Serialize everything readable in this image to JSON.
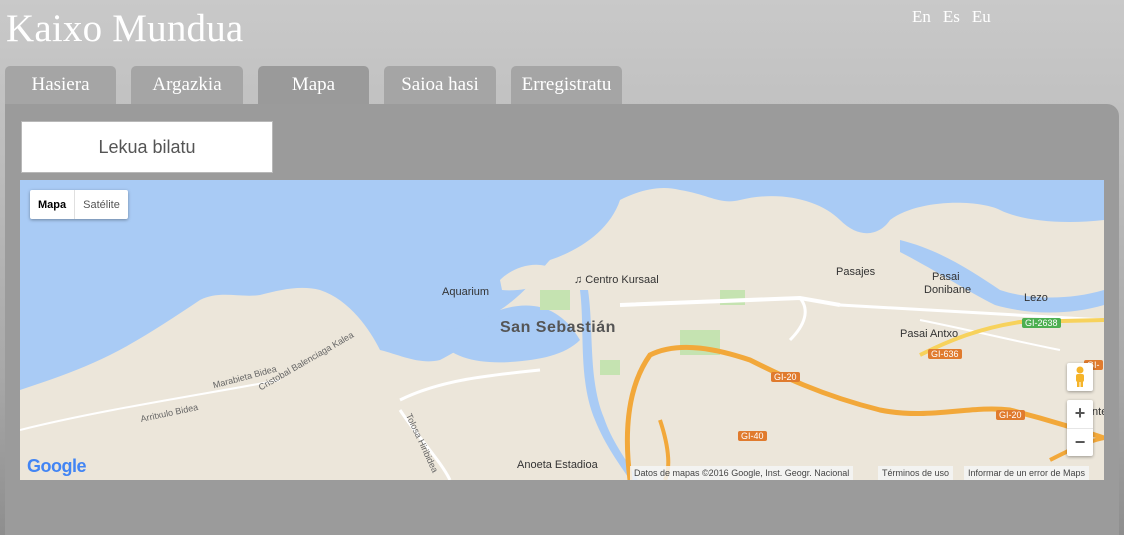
{
  "site": {
    "title": "Kaixo Mundua"
  },
  "languages": [
    "En",
    "Es",
    "Eu"
  ],
  "tabs": [
    {
      "label": "Hasiera"
    },
    {
      "label": "Argazkia"
    },
    {
      "label": "Mapa"
    },
    {
      "label": "Saioa hasi"
    },
    {
      "label": "Erregistratu"
    }
  ],
  "search": {
    "label": "Lekua bilatu"
  },
  "map": {
    "type_control": {
      "selected": "Mapa",
      "other": "Satélite"
    },
    "city": "San Sebastián",
    "places": {
      "aquarium": "Aquarium",
      "kursaal": "♫ Centro Kursaal",
      "pasajes": "Pasajes",
      "pasai_donibane_1": "Pasai",
      "pasai_donibane_2": "Donibane",
      "lezo": "Lezo",
      "pasai_antxo": "Pasai Antxo",
      "anoeta": "Anoeta Estadioa",
      "renteria": "Renteri"
    },
    "streets": {
      "arrituxulo": "Arritxulo Bidea",
      "marabieta": "Marabieta Bidea",
      "balenciaga": "Cristobal Balenciaga Kalea",
      "tolosa": "Tolosa Hiribidea"
    },
    "road_badges": {
      "gi20_a": "GI-20",
      "gi20_b": "GI-20",
      "gi40": "GI-40",
      "gi636": "GI-636",
      "gi2638": "GI-2638",
      "gi_partial": "GI-"
    },
    "zoom_in": "+",
    "zoom_out": "−",
    "google_logo": "Google",
    "attribution": "Datos de mapas ©2016 Google, Inst. Geogr. Nacional",
    "terms": "Términos de uso",
    "report": "Informar de un error de Maps",
    "colors": {
      "water": "#a9cbf5",
      "land": "#ece6da",
      "highway": "#f2a83a",
      "park": "#c5e3b1"
    }
  }
}
